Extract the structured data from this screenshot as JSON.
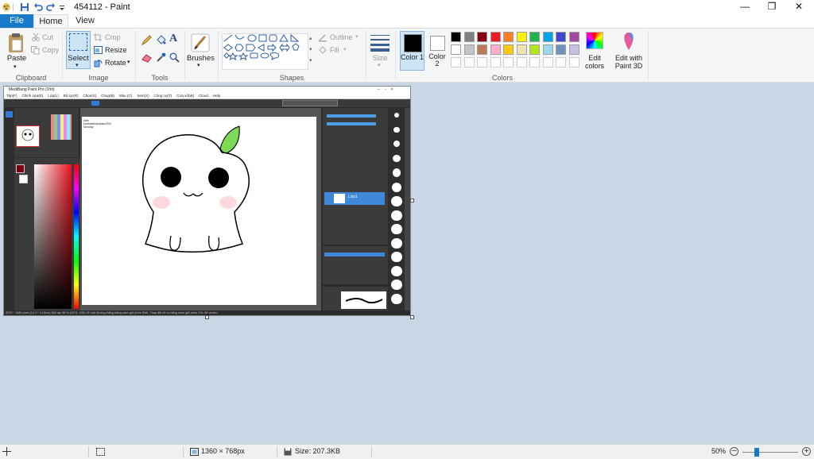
{
  "window": {
    "title": "454112 - Paint",
    "minimize": "—",
    "restore": "❐",
    "close": "✕"
  },
  "tabs": {
    "file": "File",
    "home": "Home",
    "view": "View"
  },
  "ribbon": {
    "clipboard": {
      "label": "Clipboard",
      "paste": "Paste",
      "cut": "Cut",
      "copy": "Copy"
    },
    "image": {
      "label": "Image",
      "select": "Select",
      "crop": "Crop",
      "resize": "Resize",
      "rotate": "Rotate"
    },
    "tools": {
      "label": "Tools"
    },
    "brushes": {
      "label": "Brushes"
    },
    "shapes": {
      "label": "Shapes",
      "outline": "Outline",
      "fill": "Fill"
    },
    "size": {
      "label": "Size"
    },
    "colors": {
      "label": "Colors",
      "color1": "Color 1",
      "color2": "Color 2",
      "edit": "Edit colors",
      "paint3d": "Edit with Paint 3D",
      "row1": [
        "#000000",
        "#7f7f7f",
        "#880015",
        "#ed1c24",
        "#ff7f27",
        "#fff200",
        "#22b14c",
        "#00a2e8",
        "#3f48cc",
        "#a349a4"
      ],
      "row2": [
        "#ffffff",
        "#c3c3c3",
        "#b97a57",
        "#ffaec9",
        "#ffc90e",
        "#efe4b0",
        "#b5e61d",
        "#99d9ea",
        "#7092be",
        "#c8bfe7"
      ]
    }
  },
  "picture": {
    "app_title": "MediBang Paint Pro (1fnt)",
    "menu": [
      "Tệp(F)",
      "Chỉnh sửa(E)",
      "Lớp(L)",
      "Bộ lọc(R)",
      "Chọn(S)",
      "Chụp(B)",
      "Màu (C)",
      "Xem(X)",
      "Công cụ(T)",
      "Cửa sổ(W)",
      "Cloud",
      "Help"
    ],
    "canvas_text": [
      "Kiên",
      "bobbieethepotato2004",
      "Monday"
    ],
    "layer_name": "Lớp1",
    "status_text": "2079 * 1080 pixel (14.1 * 14.5cm) 350 dpi 38 % (1572, 225) Vẽ một đường thẳng bằng cách giữ phím Shift, Thay đổi cỡ cọ bằng cách giữ phím Ctrl, Alt và kéo"
  },
  "status": {
    "dimensions": "1360 × 768px",
    "size": "Size: 207.3KB",
    "zoom": "50%"
  }
}
